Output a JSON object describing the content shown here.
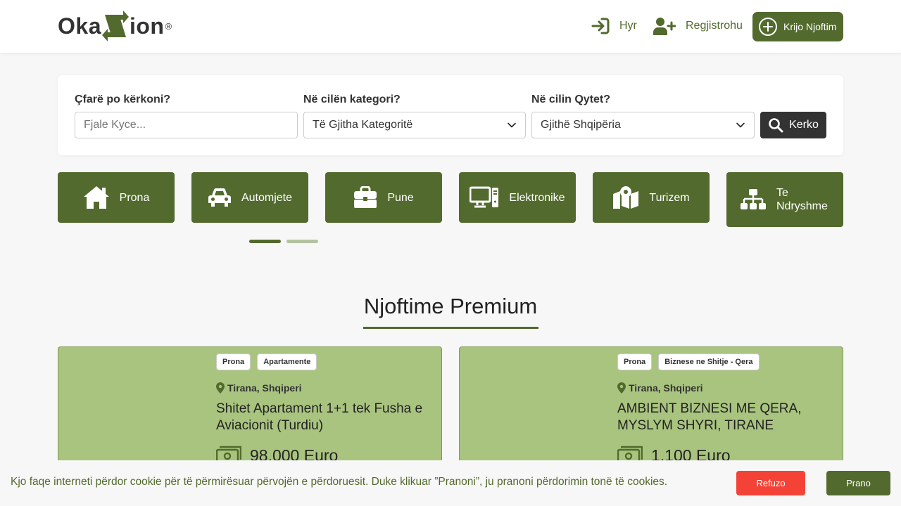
{
  "brand": {
    "logo_left": "Oka",
    "logo_right": "ion",
    "logo_mark": "®",
    "accent": "#526a2d",
    "card_bg": "#a9c47f"
  },
  "header": {
    "login_label": "Hyr",
    "register_label": "Regjistrohu",
    "create_label": "Krijo Njoftim",
    "icons": [
      "login-icon",
      "add-user-icon",
      "plus-circle-icon"
    ]
  },
  "search": {
    "keyword_label": "Çfarë po kërkoni?",
    "keyword_placeholder": "Fjale Kyce...",
    "keyword_value": "",
    "category_label": "Në cilën kategori?",
    "category_value": "Të Gjitha Kategoritë",
    "city_label": "Në cilin Qytet?",
    "city_value": "Gjithë Shqipëria",
    "button_label": "Kerko"
  },
  "categories": [
    {
      "label": "Prona",
      "icon": "house-icon"
    },
    {
      "label": "Automjete",
      "icon": "car-icon"
    },
    {
      "label": "Pune",
      "icon": "briefcase-icon"
    },
    {
      "label": "Elektronike",
      "icon": "computer-icon"
    },
    {
      "label": "Turizem",
      "icon": "map-icon"
    },
    {
      "label": "Te Ndryshme",
      "icon": "sitemap-icon"
    }
  ],
  "carousel": {
    "pages": 2,
    "active": 1
  },
  "premium": {
    "title": "Njoftime Premium",
    "listings": [
      {
        "tags": [
          "Prona",
          "Apartamente"
        ],
        "location": "Tirana, Shqiperi",
        "title": "Shitet Apartament 1+1 tek Fusha e Aviacionit (Turdiu)",
        "price": "98,000 Euro"
      },
      {
        "tags": [
          "Prona",
          "Biznese ne Shitje - Qera"
        ],
        "location": "Tirana, Shqiperi",
        "title": "AMBIENT BIZNESI ME QERA, MYSLYM SHYRI, TIRANE",
        "price": "1,100 Euro"
      }
    ]
  },
  "cookie": {
    "text": "Kjo faqe interneti përdor cookie për të përmirësuar përvojën e përdoruesit. Duke klikuar ”Pranoni”, ju pranoni përdorimin tonë të cookies.",
    "refuse_label": "Refuzo",
    "accept_label": "Prano",
    "refuse_color": "#f44336"
  }
}
